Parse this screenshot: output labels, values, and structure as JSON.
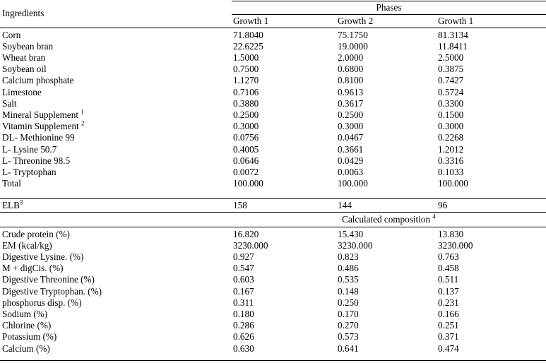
{
  "table": {
    "stub_header": "Ingredients",
    "group_header": "Phases",
    "column_headers": [
      "Growth 1",
      "Growth 2",
      "Growth 1"
    ],
    "section_header": {
      "text": "Calculated composition",
      "superscript": "4"
    },
    "ingredients_rows": [
      {
        "label": "Corn",
        "sup": "",
        "values": [
          "71.8040",
          "75.1750",
          "81.3134"
        ]
      },
      {
        "label": "Soybean bran",
        "sup": "",
        "values": [
          "22.6225",
          "19.0000",
          "11.8411"
        ]
      },
      {
        "label": "Wheat bran",
        "sup": "",
        "values": [
          "1.5000",
          "2.0000",
          "2.5000"
        ]
      },
      {
        "label": "Soybean oil",
        "sup": "",
        "values": [
          "0.7500",
          "0.6800",
          "0.3875"
        ]
      },
      {
        "label": "Calcium phosphate",
        "sup": "",
        "values": [
          "1.1270",
          "0.8100",
          "0.7427"
        ]
      },
      {
        "label": "Limestone",
        "sup": "",
        "values": [
          "0.7106",
          "0.9613",
          "0.5724"
        ]
      },
      {
        "label": "Salt",
        "sup": "",
        "values": [
          "0.3880",
          "0.3617",
          "0.3300"
        ]
      },
      {
        "label": "Mineral Supplement",
        "sup": "1",
        "values": [
          "0.2500",
          "0.2500",
          "0.1500"
        ]
      },
      {
        "label": "Vitamin Supplement",
        "sup": "2",
        "values": [
          "0.3000",
          "0.3000",
          "0.3000"
        ]
      },
      {
        "label": "DL- Methionine 99",
        "sup": "",
        "values": [
          "0.0756",
          "0.0467",
          "0.2268"
        ]
      },
      {
        "label": "L- Lysine 50.7",
        "sup": "",
        "values": [
          "0.4005",
          "0.3661",
          "1.2012"
        ]
      },
      {
        "label": "L- Threonine 98.5",
        "sup": "",
        "values": [
          "0.0646",
          "0.0429",
          "0.3316"
        ]
      },
      {
        "label": "L- Tryptophan",
        "sup": "",
        "values": [
          "0.0072",
          "0.0063",
          "0.1033"
        ]
      },
      {
        "label": "Total",
        "sup": "",
        "values": [
          "100.000",
          "100.000",
          "100.000"
        ]
      }
    ],
    "elb_row": {
      "label": "ELB",
      "sup": "3",
      "values": [
        "158",
        "144",
        "96"
      ]
    },
    "composition_rows": [
      {
        "label": "Crude protein (%)",
        "values": [
          "16.820",
          "15.430",
          "13.830"
        ]
      },
      {
        "label": "EM (kcal/kg)",
        "values": [
          "3230.000",
          "3230.000",
          "3230.000"
        ]
      },
      {
        "label": "Digestive Lysine. (%)",
        "values": [
          "0.927",
          "0.823",
          "0.763"
        ]
      },
      {
        "label": "M + digCis. (%)",
        "values": [
          "0.547",
          "0.486",
          "0.458"
        ]
      },
      {
        "label": "Digestive Threonine  (%)",
        "values": [
          "0.603",
          "0.535",
          "0.511"
        ]
      },
      {
        "label": "Digestive Tryptophan. (%)",
        "values": [
          "0.167",
          "0.148",
          "0.137"
        ]
      },
      {
        "label": "phosphorus disp. (%)",
        "values": [
          "0.311",
          "0.250",
          "0.231"
        ]
      },
      {
        "label": "Sodium (%)",
        "values": [
          "0.180",
          "0.170",
          "0.166"
        ]
      },
      {
        "label": "Chlorine (%)",
        "values": [
          "0.286",
          "0.270",
          "0.251"
        ]
      },
      {
        "label": "Potassium (%)",
        "values": [
          "0.626",
          "0.573",
          "0.371"
        ]
      },
      {
        "label": "Calcium (%)",
        "values": [
          "0.630",
          "0.641",
          "0.474"
        ]
      }
    ]
  }
}
